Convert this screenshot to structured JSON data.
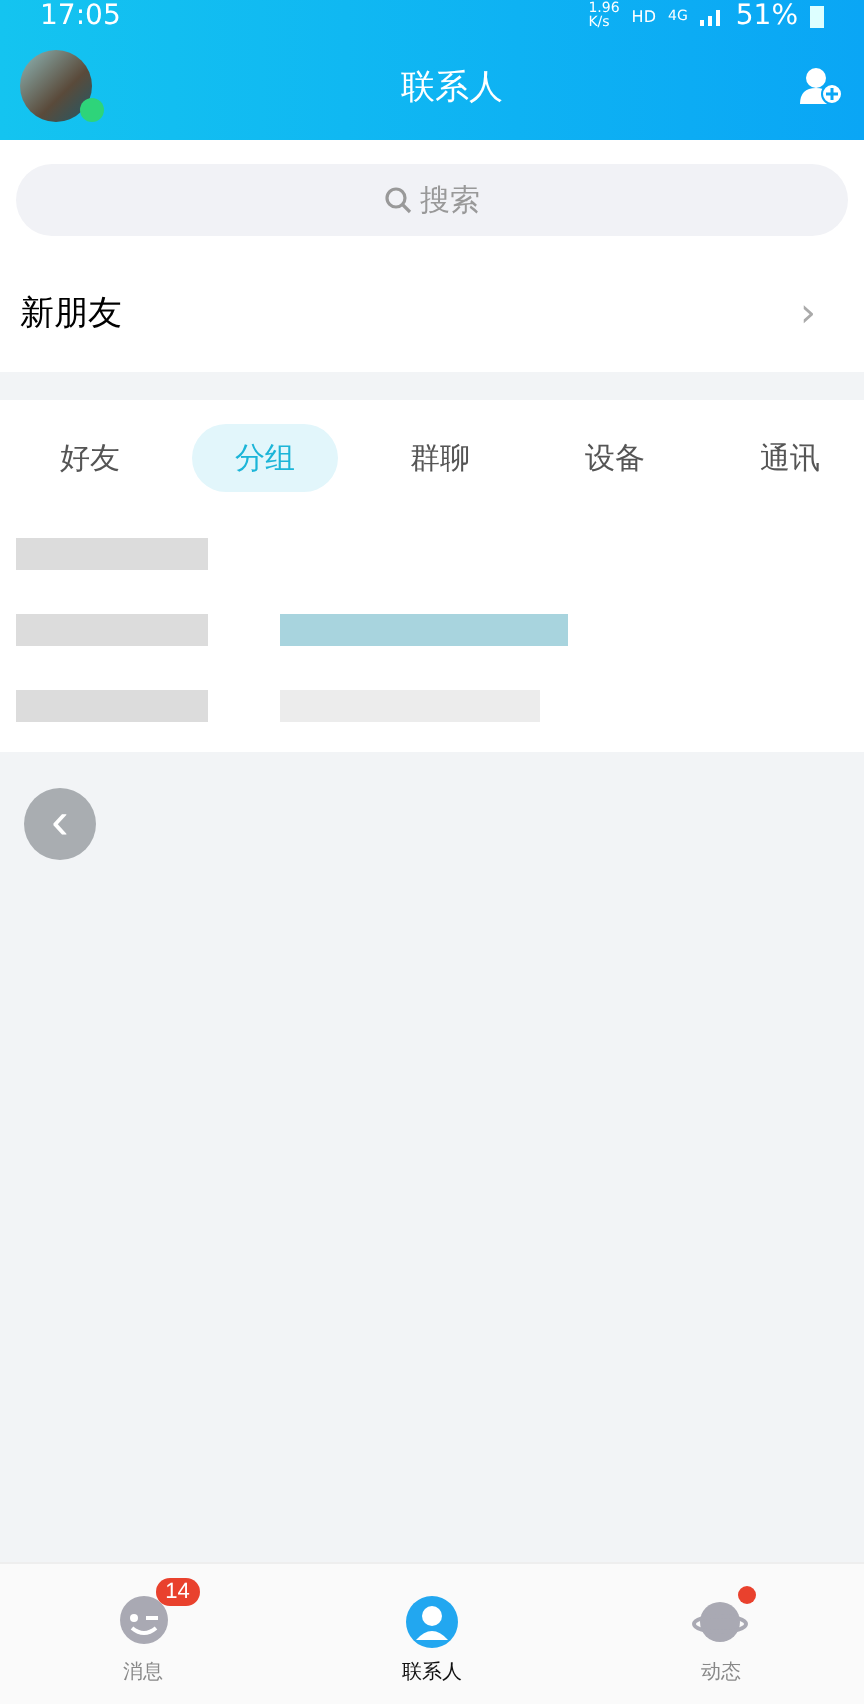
{
  "status_bar": {
    "time": "17:05",
    "speed": "1.96\nK/s",
    "hd": "HD",
    "network": "4G",
    "battery": "51%"
  },
  "header": {
    "title": "联系人"
  },
  "search": {
    "placeholder": "搜索"
  },
  "new_friends": {
    "label": "新朋友",
    "arrow": "›"
  },
  "tabs": [
    {
      "label": "好友",
      "selected": false
    },
    {
      "label": "分组",
      "selected": true
    },
    {
      "label": "群聊",
      "selected": false
    },
    {
      "label": "设备",
      "selected": false
    },
    {
      "label": "通讯",
      "selected": false
    }
  ],
  "rows": [
    {
      "kind": "plain"
    },
    {
      "kind": "highlight"
    },
    {
      "kind": "plain"
    }
  ],
  "back_button": {
    "label": "‹"
  },
  "bottom_nav": [
    {
      "label": "消息",
      "selected": false,
      "badge": "14",
      "dot": false,
      "kind": "chat"
    },
    {
      "label": "联系人",
      "selected": true,
      "dot": false,
      "kind": "person"
    },
    {
      "label": "动态",
      "selected": false,
      "dot": true,
      "kind": "planet"
    }
  ]
}
